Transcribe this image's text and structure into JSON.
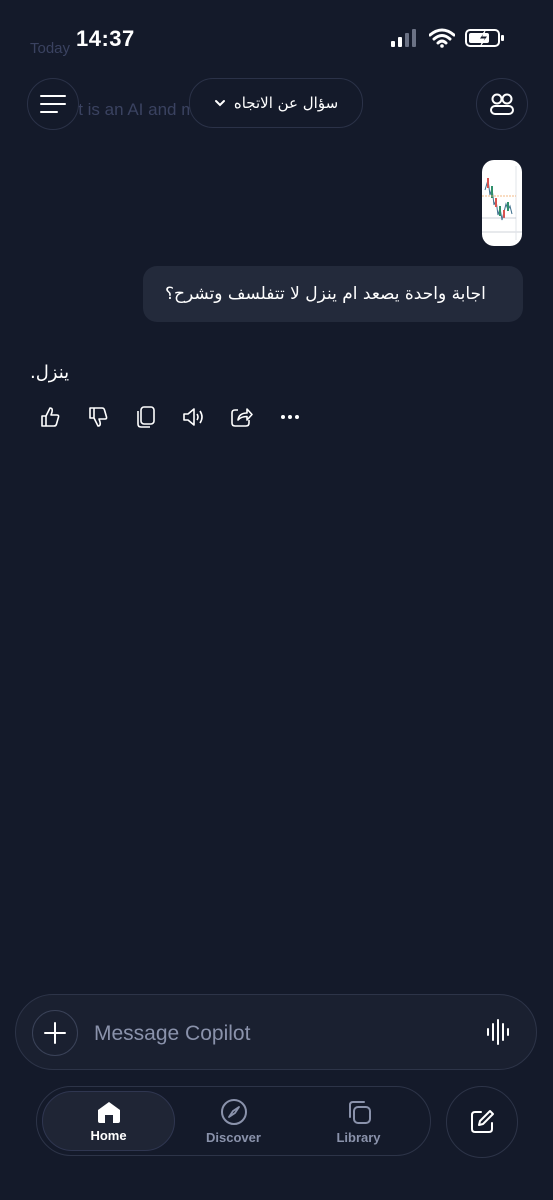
{
  "status_bar": {
    "time": "14:37"
  },
  "background_text": {
    "top": "Today",
    "line": "Copilot is an AI and may make mistakes."
  },
  "header": {
    "topic_title": "سؤال عن الاتجاه"
  },
  "conversation": {
    "user_message": "اجابة واحدة يصعد ام ينزل لا تتفلسف وتشرح؟",
    "assistant_reply": "ينزل."
  },
  "composer": {
    "placeholder": "Message Copilot"
  },
  "tabs": [
    {
      "label": "Home",
      "icon": "home-icon",
      "active": true
    },
    {
      "label": "Discover",
      "icon": "compass-icon",
      "active": false
    },
    {
      "label": "Library",
      "icon": "stack-icon",
      "active": false
    }
  ],
  "colors": {
    "background": "#141a2a",
    "bubble": "#232a3b",
    "muted": "#8a92ab"
  }
}
